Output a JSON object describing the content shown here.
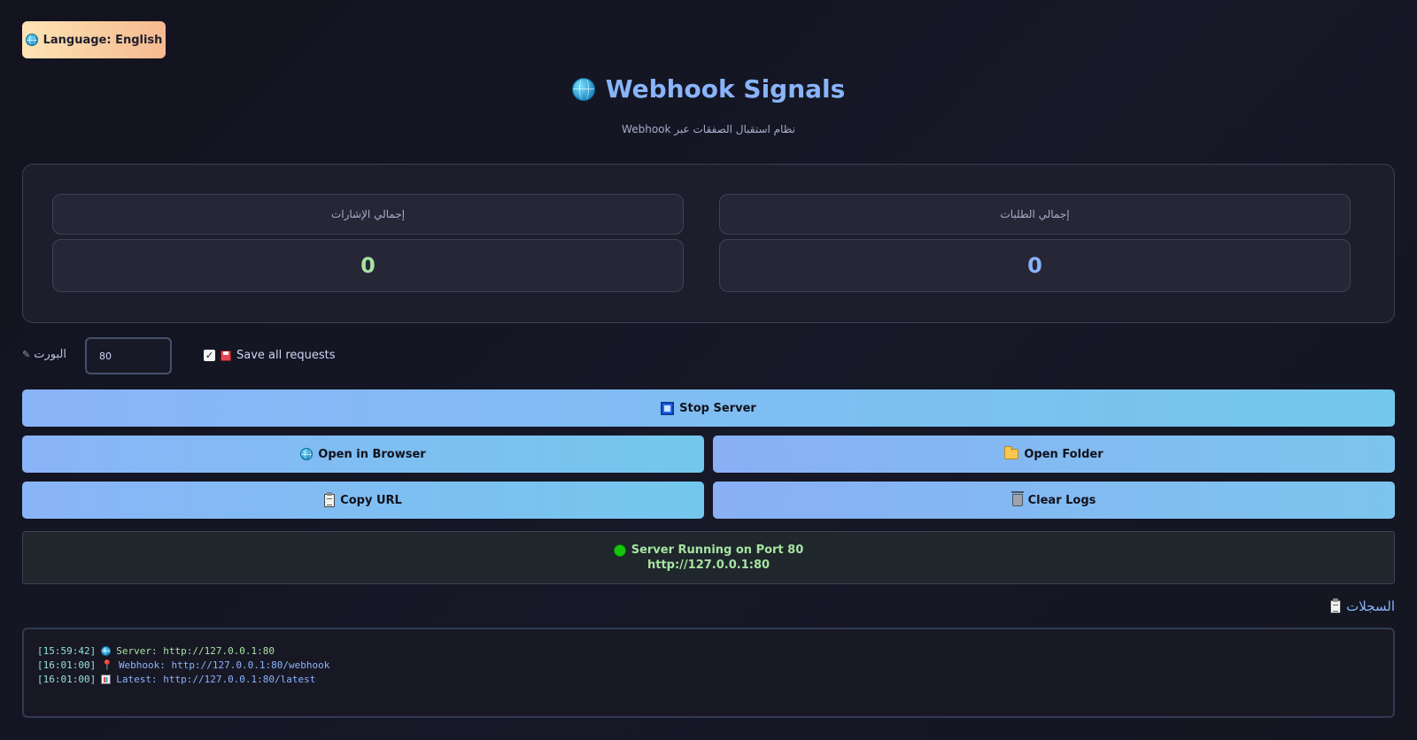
{
  "language_button": {
    "label": "Language: English",
    "icon": "globe-icon"
  },
  "header": {
    "title": "Webhook Signals",
    "title_icon": "globe-icon",
    "subtitle": "نظام استقبال الصفقات عبر Webhook"
  },
  "stats": {
    "signals": {
      "label": "إجمالي الإشارات",
      "value": "0",
      "color": "#a6e3a1"
    },
    "requests": {
      "label": "إجمالي الطلبات",
      "value": "0",
      "color": "#89b4fa"
    }
  },
  "controls": {
    "port_label": "البورت",
    "port_icon": "✎",
    "port_value": "80",
    "save_all_label": "Save all requests",
    "save_all_checked": true,
    "save_icon": "floppy-icon"
  },
  "buttons": {
    "stop_server": "Stop Server",
    "open_browser": "Open in Browser",
    "open_folder": "Open Folder",
    "copy_url": "Copy URL",
    "clear_logs": "Clear Logs"
  },
  "status": {
    "line1": "Server Running on Port 80",
    "line2": "http://127.0.0.1:80",
    "indicator_color": "#16c60c"
  },
  "logs": {
    "title": "السجلات",
    "entries": [
      {
        "time": "[15:59:42]",
        "icon": "globe-icon",
        "text": "Server: http://127.0.0.1:80"
      },
      {
        "time": "[16:01:00]",
        "icon": "pin-icon",
        "text": "Webhook: http://127.0.0.1:80/webhook"
      },
      {
        "time": "[16:01:00]",
        "icon": "chart-icon",
        "text": "Latest: http://127.0.0.1:80/latest"
      }
    ]
  },
  "colors": {
    "accent_blue": "#89b4fa",
    "accent_green": "#a6e3a1",
    "button_gradient_start": "#8ab4f8",
    "button_gradient_end": "#74c7ec"
  }
}
